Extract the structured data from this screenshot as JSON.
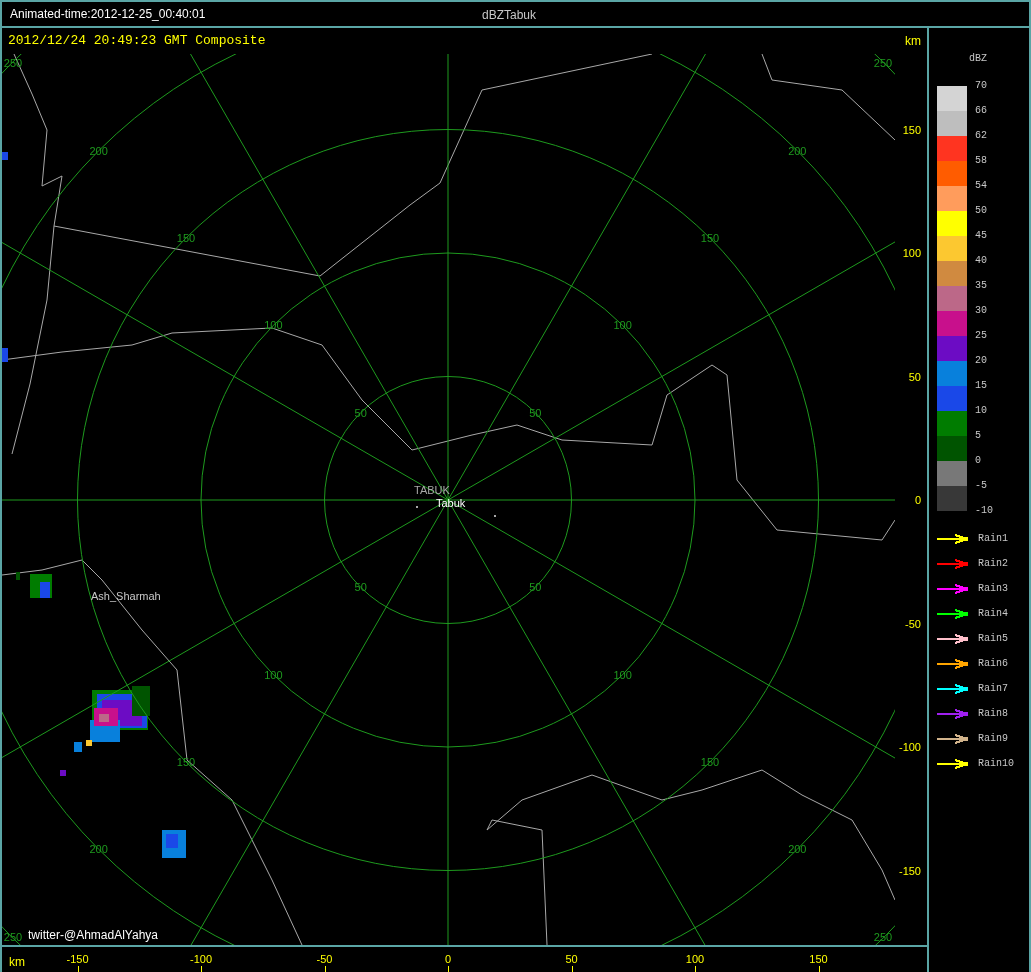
{
  "title_bar": {
    "animation_time": "Animated-time:2012-12-25_00:40:01",
    "title": "dBZTabuk"
  },
  "plot": {
    "scan_time": "2012/12/24 20:49:23 GMT Composite",
    "unit_top": "km",
    "unit_bottom": "km",
    "range_rings": [
      {
        "labels": [
          "50",
          "50",
          "50",
          "50"
        ]
      },
      {
        "labels": [
          "100",
          "100",
          "100",
          "100"
        ]
      },
      {
        "labels": [
          "150",
          "150",
          "150",
          "150"
        ]
      },
      {
        "labels": [
          "200",
          "200",
          "200",
          "200"
        ]
      },
      {
        "labels": [
          "250",
          "250",
          "250",
          "250"
        ]
      }
    ],
    "places": [
      {
        "name": "TABUK",
        "kind": "station"
      },
      {
        "name": "Tabuk",
        "kind": "city"
      },
      {
        "name": "Ash_Sharmah",
        "kind": "town"
      }
    ],
    "credit": "twitter-@AhmadAlYahya",
    "y_ticks": [
      "150",
      "100",
      "50",
      "0",
      "-50",
      "-100",
      "-150"
    ],
    "x_ticks": [
      "-150",
      "-100",
      "-50",
      "0",
      "50",
      "100",
      "150"
    ]
  },
  "legend": {
    "title": "dBZ",
    "values": [
      "70",
      "66",
      "62",
      "58",
      "54",
      "50",
      "45",
      "40",
      "35",
      "30",
      "25",
      "20",
      "15",
      "10",
      "5",
      "0",
      "-5",
      "-10"
    ],
    "bands": [
      {
        "color": "#d4d4d4"
      },
      {
        "color": "#bebebe"
      },
      {
        "color": "#ff3420"
      },
      {
        "color": "#ff5c00"
      },
      {
        "color": "#ff9c5c"
      },
      {
        "color": "#ffff00"
      },
      {
        "color": "#fcc830"
      },
      {
        "color": "#d08a40"
      },
      {
        "color": "#bc6888"
      },
      {
        "color": "#c8108c"
      },
      {
        "color": "#6c0cc4"
      },
      {
        "color": "#0880dc"
      },
      {
        "color": "#1a48e8"
      },
      {
        "color": "#007c00"
      },
      {
        "color": "#005400"
      },
      {
        "color": "#787878"
      },
      {
        "color": "#383838"
      }
    ],
    "tracks": [
      {
        "label": "Rain1",
        "color": "#ffff00"
      },
      {
        "label": "Rain2",
        "color": "#ff0000"
      },
      {
        "label": "Rain3",
        "color": "#ff00ff"
      },
      {
        "label": "Rain4",
        "color": "#00ff00"
      },
      {
        "label": "Rain5",
        "color": "#ffc0cb"
      },
      {
        "label": "Rain6",
        "color": "#ffa500"
      },
      {
        "label": "Rain7",
        "color": "#00ffff"
      },
      {
        "label": "Rain8",
        "color": "#a020f0"
      },
      {
        "label": "Rain9",
        "color": "#d2b48c"
      },
      {
        "label": "Rain10",
        "color": "#ffff00"
      }
    ]
  }
}
